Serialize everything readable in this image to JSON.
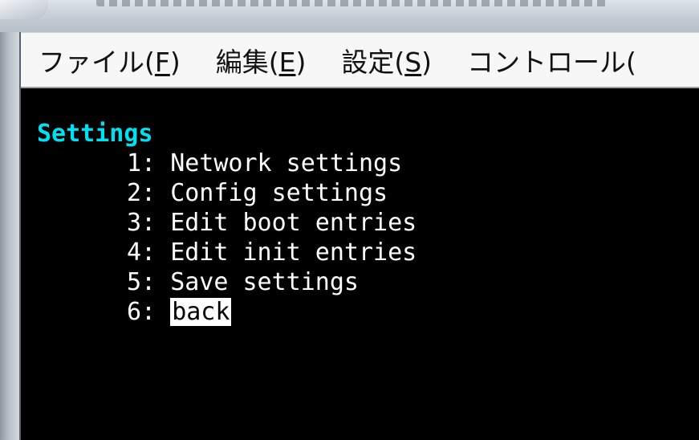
{
  "menubar": {
    "items": [
      {
        "label": "ファイル(",
        "accel": "F",
        "suffix": ")"
      },
      {
        "label": "編集(",
        "accel": "E",
        "suffix": ")"
      },
      {
        "label": "設定(",
        "accel": "S",
        "suffix": ")"
      },
      {
        "label": "コントロール(",
        "accel": "",
        "suffix": ""
      }
    ]
  },
  "terminal": {
    "heading": "Settings",
    "items": [
      {
        "num": "1:",
        "label": "Network settings"
      },
      {
        "num": "2:",
        "label": "Config settings"
      },
      {
        "num": "3:",
        "label": "Edit boot entries"
      },
      {
        "num": "4:",
        "label": "Edit init entries"
      },
      {
        "num": "5:",
        "label": "Save settings"
      },
      {
        "num": "6:",
        "label": "back",
        "selected": true
      }
    ]
  },
  "colors": {
    "terminal_bg": "#000000",
    "terminal_fg": "#ffffff",
    "heading": "#00e0f0",
    "menubar_bg": "#f7f7f7"
  }
}
